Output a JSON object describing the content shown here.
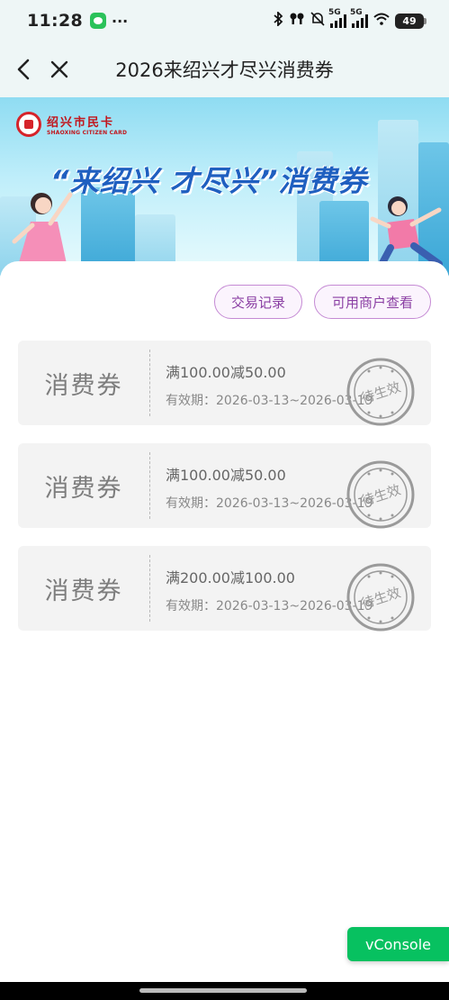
{
  "status_bar": {
    "time": "11:28",
    "dots": "···",
    "battery": "49",
    "net1": "5G",
    "net2": "5G"
  },
  "nav": {
    "title": "2026来绍兴才尽兴消费券"
  },
  "banner": {
    "logo_cn": "绍兴市民卡",
    "logo_en": "SHAOXING CITIZEN CARD",
    "slogan": "“来绍兴  才尽兴”消费券"
  },
  "actions": {
    "records_label": "交易记录",
    "merchants_label": "可用商户查看"
  },
  "coupons": [
    {
      "type_label": "消费券",
      "title": "满100.00减50.00",
      "validity": "有效期：2026-03-13~2026-03-19",
      "stamp_text": "待生效"
    },
    {
      "type_label": "消费券",
      "title": "满100.00减50.00",
      "validity": "有效期：2026-03-13~2026-03-19",
      "stamp_text": "待生效"
    },
    {
      "type_label": "消费券",
      "title": "满200.00减100.00",
      "validity": "有效期：2026-03-13~2026-03-19",
      "stamp_text": "待生效"
    }
  ],
  "vconsole_label": "vConsole",
  "colors": {
    "accent_purple": "#8a3ea3",
    "brand_red": "#d6232a",
    "slogan_blue": "#1f5fc0",
    "vconsole_green": "#07c160"
  }
}
